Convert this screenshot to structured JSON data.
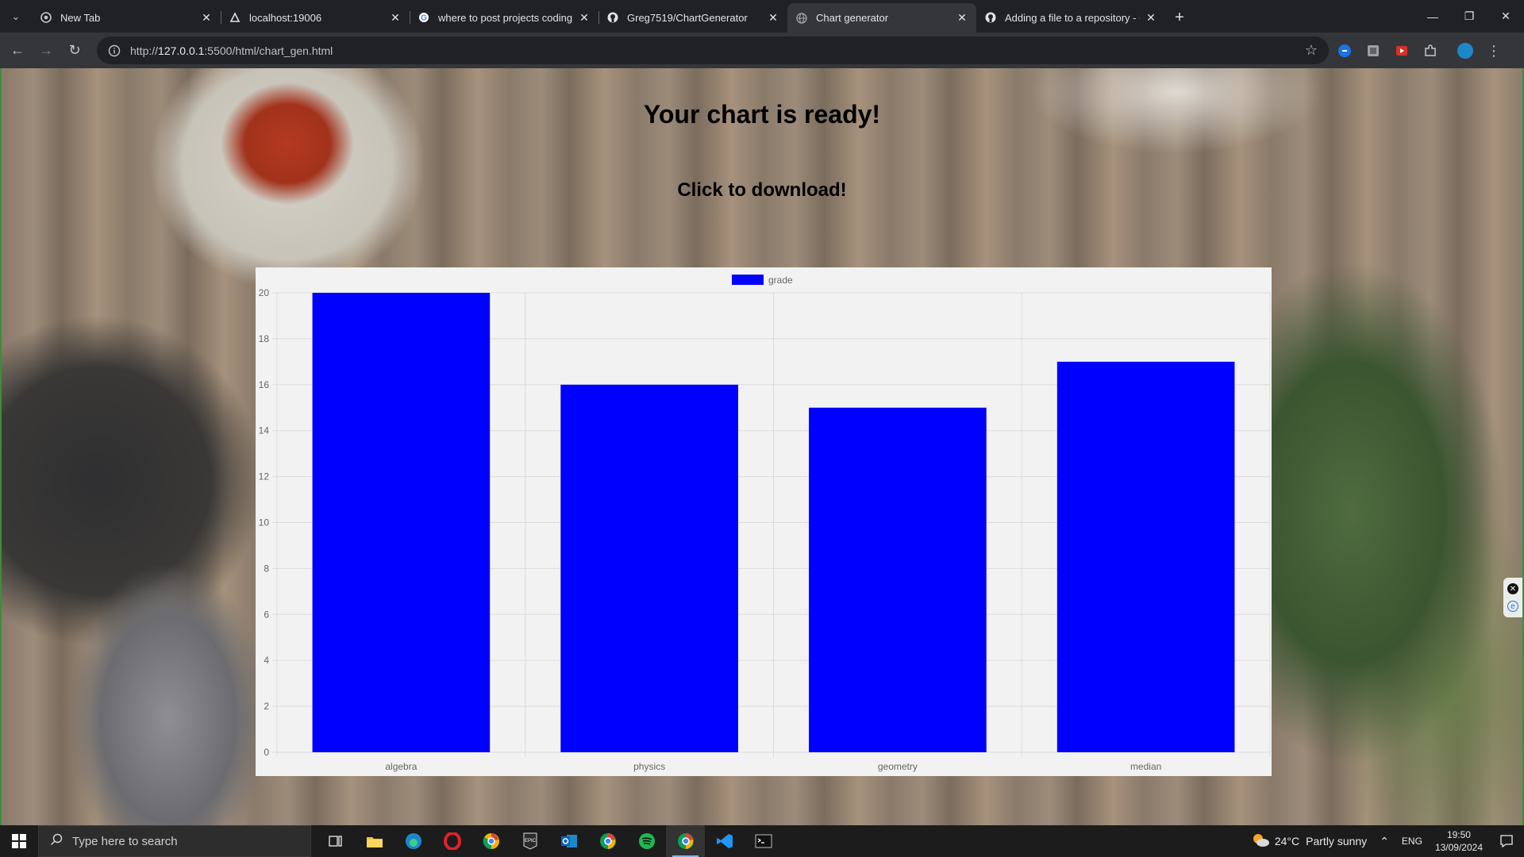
{
  "browser": {
    "tabs": [
      {
        "title": "New Tab",
        "favicon": "chrome-icon",
        "active": false
      },
      {
        "title": "localhost:19006",
        "favicon": "expo-icon",
        "active": false
      },
      {
        "title": "where to post projects coding -",
        "favicon": "google-icon",
        "active": false
      },
      {
        "title": "Greg7519/ChartGenerator",
        "favicon": "github-icon",
        "active": false
      },
      {
        "title": "Chart generator",
        "favicon": "globe-icon",
        "active": true
      },
      {
        "title": "Adding a file to a repository - G",
        "favicon": "github-icon",
        "active": false
      }
    ],
    "url_prefix": "http://",
    "url_host": "127.0.0.1",
    "url_rest": ":5500/html/chart_gen.html"
  },
  "page": {
    "title": "Your chart is ready!",
    "subtitle": "Click to download!"
  },
  "chart_data": {
    "type": "bar",
    "categories": [
      "algebra",
      "physics",
      "geometry",
      "median"
    ],
    "series": [
      {
        "name": "grade",
        "values": [
          20,
          16,
          15,
          17
        ],
        "color": "#0000ff"
      }
    ],
    "ylim": [
      0,
      20
    ],
    "yticks": [
      0,
      2,
      4,
      6,
      8,
      10,
      12,
      14,
      16,
      18,
      20
    ],
    "grid": true,
    "legend_position": "top-center",
    "background": "#f2f2f2"
  },
  "taskbar": {
    "search_placeholder": "Type here to search",
    "apps": [
      "task-view-icon",
      "file-explorer-icon",
      "edge-icon",
      "opera-icon",
      "chrome-canary-icon",
      "epic-games-icon",
      "outlook-icon",
      "chrome-icon",
      "spotify-icon",
      "chrome-active-icon",
      "vscode-icon",
      "terminal-icon"
    ],
    "weather_temp": "24°C",
    "weather_text": "Partly sunny",
    "language": "ENG",
    "time": "19:50",
    "date": "13/09/2024"
  }
}
